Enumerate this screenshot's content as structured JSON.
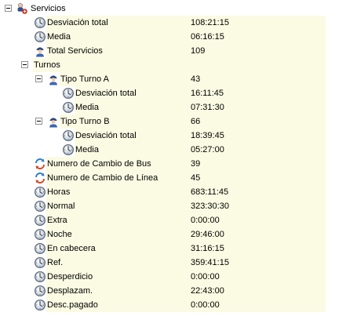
{
  "tree": {
    "root": {
      "label": "Servicios",
      "icon": "services-group-icon"
    },
    "rows": [
      {
        "id": "desviacion-total",
        "level": 1,
        "icon": "clock-icon",
        "label": "Desviación total",
        "value": "108:21:15"
      },
      {
        "id": "media",
        "level": 1,
        "icon": "clock-icon",
        "label": "Media",
        "value": "06:16:15"
      },
      {
        "id": "total-servicios",
        "level": 1,
        "icon": "person-icon",
        "label": "Total Servicios",
        "value": "109"
      },
      {
        "id": "turnos",
        "level": 1,
        "icon": "",
        "label": "Turnos",
        "value": "",
        "expandable": true
      },
      {
        "id": "tipo-turno-a",
        "level": 2,
        "icon": "person-icon",
        "label": "Tipo Turno A",
        "value": "43",
        "expandable": true
      },
      {
        "id": "turno-a-desviacion-total",
        "level": 3,
        "icon": "clock-icon",
        "label": "Desviación total",
        "value": "16:11:45"
      },
      {
        "id": "turno-a-media",
        "level": 3,
        "icon": "clock-icon",
        "label": "Media",
        "value": "07:31:30"
      },
      {
        "id": "tipo-turno-b",
        "level": 2,
        "icon": "person-icon",
        "label": "Tipo Turno B",
        "value": "66",
        "expandable": true
      },
      {
        "id": "turno-b-desviacion-total",
        "level": 3,
        "icon": "clock-icon",
        "label": "Desviación total",
        "value": "18:39:45"
      },
      {
        "id": "turno-b-media",
        "level": 3,
        "icon": "clock-icon",
        "label": "Media",
        "value": "05:27:00"
      },
      {
        "id": "cambio-bus",
        "level": 1,
        "icon": "exchange-icon",
        "label": "Numero de Cambio de Bus",
        "value": "39"
      },
      {
        "id": "cambio-linea",
        "level": 1,
        "icon": "exchange-icon",
        "label": "Numero de Cambio de Línea",
        "value": "45"
      },
      {
        "id": "horas",
        "level": 1,
        "icon": "clock-icon",
        "label": "Horas",
        "value": "683:11:45"
      },
      {
        "id": "normal",
        "level": 1,
        "icon": "clock-icon",
        "label": "Normal",
        "value": "323:30:30"
      },
      {
        "id": "extra",
        "level": 1,
        "icon": "clock-icon",
        "label": "Extra",
        "value": "0:00:00"
      },
      {
        "id": "noche",
        "level": 1,
        "icon": "clock-icon",
        "label": "Noche",
        "value": "29:46:00"
      },
      {
        "id": "en-cabecera",
        "level": 1,
        "icon": "clock-icon",
        "label": "En cabecera",
        "value": "31:16:15"
      },
      {
        "id": "ref",
        "level": 1,
        "icon": "clock-icon",
        "label": "Ref.",
        "value": "359:41:15"
      },
      {
        "id": "desperdicio",
        "level": 1,
        "icon": "clock-icon",
        "label": "Desperdicio",
        "value": "0:00:00"
      },
      {
        "id": "desplazam",
        "level": 1,
        "icon": "clock-icon",
        "label": "Desplazam.",
        "value": "22:43:00"
      },
      {
        "id": "desc-pagado",
        "level": 1,
        "icon": "clock-icon",
        "label": "Desc.pagado",
        "value": "0:00:00"
      }
    ]
  }
}
